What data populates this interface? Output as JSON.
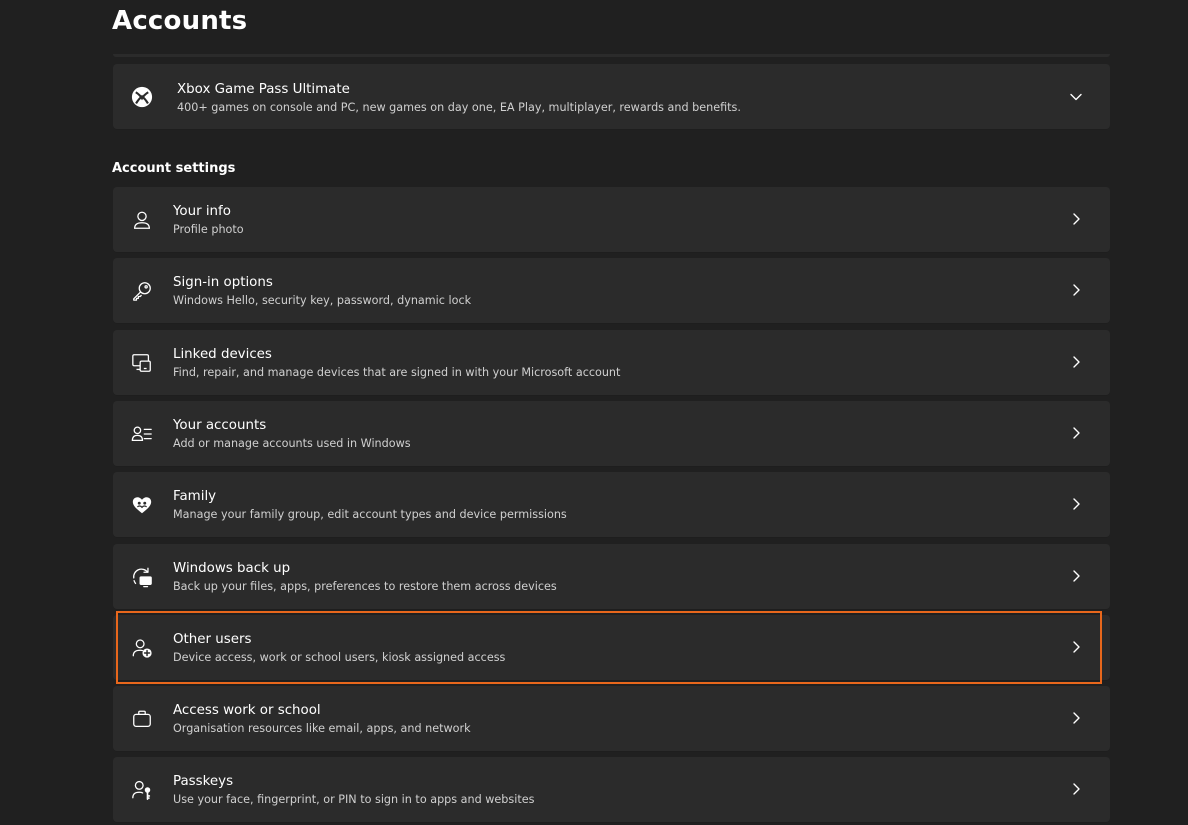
{
  "page": {
    "title": "Accounts"
  },
  "xbox": {
    "title": "Xbox Game Pass Ultimate",
    "desc": "400+ games on console and PC, new games on day one, EA Play, multiplayer, rewards and benefits.",
    "icon": "xbox-icon"
  },
  "section": {
    "title": "Account settings"
  },
  "items": [
    {
      "title": "Your info",
      "desc": "Profile photo",
      "icon": "person-icon"
    },
    {
      "title": "Sign-in options",
      "desc": "Windows Hello, security key, password, dynamic lock",
      "icon": "key-icon"
    },
    {
      "title": "Linked devices",
      "desc": "Find, repair, and manage devices that are signed in with your Microsoft account",
      "icon": "devices-icon"
    },
    {
      "title": "Your accounts",
      "desc": "Add or manage accounts used in Windows",
      "icon": "person-list-icon"
    },
    {
      "title": "Family",
      "desc": "Manage your family group, edit account types and device permissions",
      "icon": "family-heart-icon"
    },
    {
      "title": "Windows back up",
      "desc": "Back up your files, apps, preferences to restore them across devices",
      "icon": "backup-icon"
    },
    {
      "title": "Other users",
      "desc": "Device access, work or school users, kiosk assigned access",
      "icon": "person-add-icon"
    },
    {
      "title": "Access work or school",
      "desc": "Organisation resources like email, apps, and network",
      "icon": "briefcase-icon"
    },
    {
      "title": "Passkeys",
      "desc": "Use your face, fingerprint, or PIN to sign in to apps and websites",
      "icon": "passkey-icon"
    }
  ],
  "colors": {
    "background": "#202020",
    "card": "#2b2b2b",
    "highlight": "#e8671c"
  }
}
